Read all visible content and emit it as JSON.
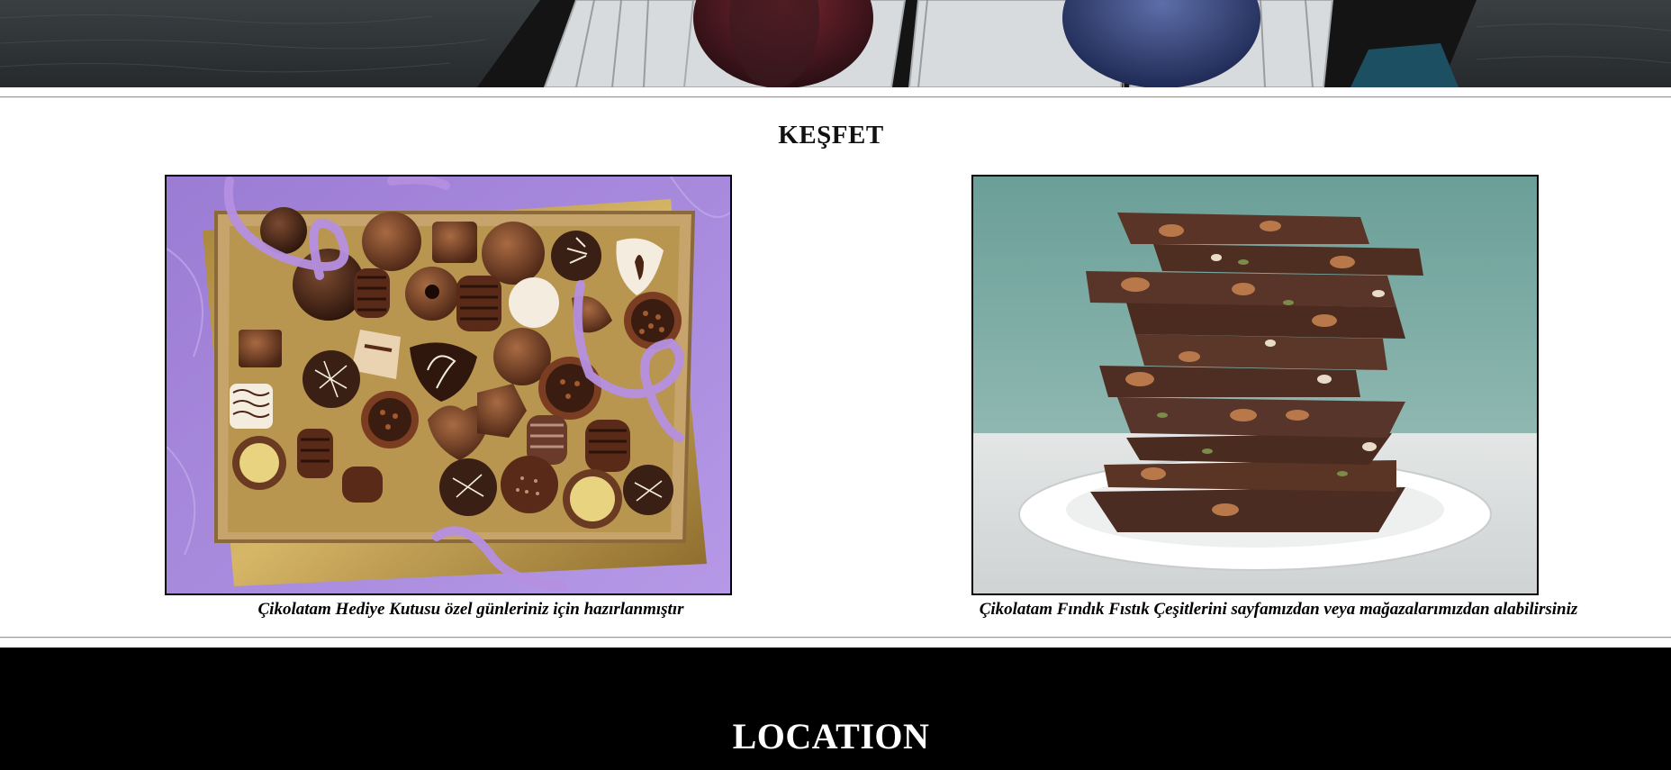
{
  "discover": {
    "title": "KEŞFET",
    "items": [
      {
        "image_alt": "Çikolata hediye kutusu",
        "caption": "Çikolatam Hediye Kutusu özel günleriniz için hazırlanmıştır"
      },
      {
        "image_alt": "Fındık fıstıklı çikolata",
        "caption": "Çikolatam Fındık Fıstık Çeşitlerini sayfamızdan veya mağazalarımızdan alabilirsiniz"
      }
    ]
  },
  "location": {
    "title": "LOCATION"
  },
  "colors": {
    "footer_bg": "#000000",
    "page_bg": "#ffffff",
    "chocolate": "#4a2a1c",
    "lavender": "#b58fe0"
  },
  "icons": {
    "hero": "chocolate-box-photo",
    "figure_1": "gift-box-photo",
    "figure_2": "chocolate-bark-stack-photo"
  }
}
